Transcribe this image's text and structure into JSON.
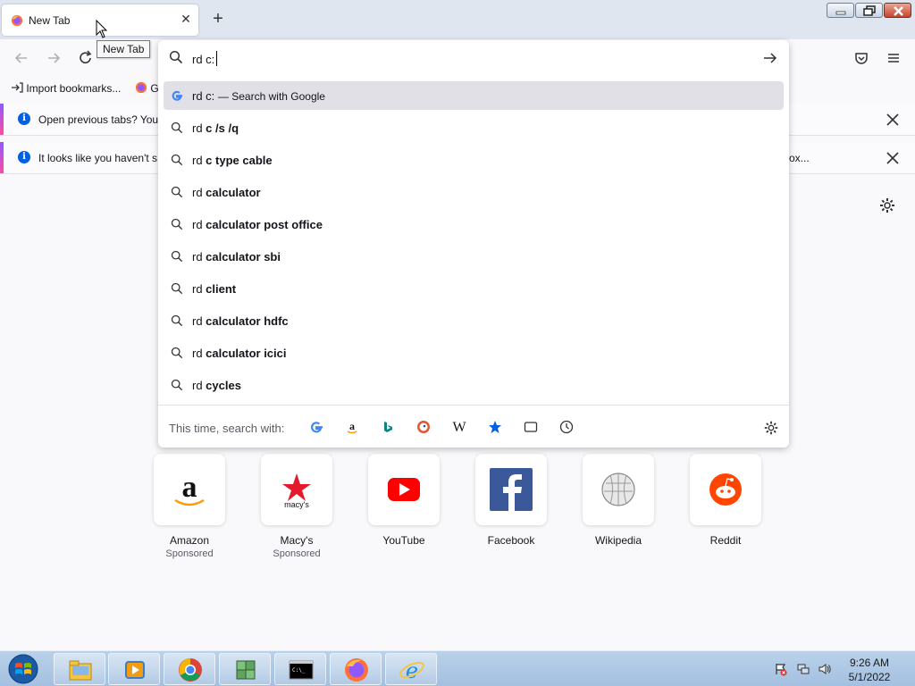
{
  "browser": {
    "tab": {
      "title": "New Tab",
      "tooltip": "New Tab"
    },
    "bookmarks": [
      {
        "label": "Import bookmarks...",
        "icon": "import-icon"
      },
      {
        "label": "G",
        "icon": "firefox-icon"
      }
    ],
    "notifications": [
      {
        "text": "Open previous tabs? You",
        "icon": "info-icon"
      },
      {
        "text": "It looks like you haven't s",
        "extra": "ox...",
        "icon": "info-icon"
      }
    ]
  },
  "urlbar": {
    "typed": "rd c:",
    "results": [
      {
        "prefix": "rd c:",
        "bold": "",
        "action": "— Search with Google",
        "icon": "google-icon"
      },
      {
        "prefix": "rd ",
        "bold": "c /s /q",
        "icon": "search-icon"
      },
      {
        "prefix": "rd ",
        "bold": "c type cable",
        "icon": "search-icon"
      },
      {
        "prefix": "rd ",
        "bold": "calculator",
        "icon": "search-icon"
      },
      {
        "prefix": "rd ",
        "bold": "calculator post office",
        "icon": "search-icon"
      },
      {
        "prefix": "rd ",
        "bold": "calculator sbi",
        "icon": "search-icon"
      },
      {
        "prefix": "rd ",
        "bold": "client",
        "icon": "search-icon"
      },
      {
        "prefix": "rd ",
        "bold": "calculator hdfc",
        "icon": "search-icon"
      },
      {
        "prefix": "rd ",
        "bold": "calculator icici",
        "icon": "search-icon"
      },
      {
        "prefix": "rd ",
        "bold": "cycles",
        "icon": "search-icon"
      }
    ],
    "one_off_label": "This time, search with:",
    "engines": [
      "google",
      "amazon",
      "bing",
      "duckduckgo",
      "wikipedia",
      "bookmarks",
      "tabs",
      "history"
    ]
  },
  "top_sites": [
    {
      "name": "Amazon",
      "sponsored": "Sponsored"
    },
    {
      "name": "Macy's",
      "sponsored": "Sponsored"
    },
    {
      "name": "YouTube"
    },
    {
      "name": "Facebook"
    },
    {
      "name": "Wikipedia"
    },
    {
      "name": "Reddit"
    }
  ],
  "taskbar": {
    "apps": [
      "explorer",
      "media-player",
      "chrome",
      "network-app",
      "command-prompt",
      "firefox",
      "internet-explorer"
    ],
    "time": "9:26 AM",
    "date": "5/1/2022"
  },
  "colors": {
    "accent": "#0060df",
    "taskbar": "#a4c0e0",
    "notif_stripe_top": "#9059ff",
    "notif_stripe_bottom": "#ff4aa2"
  }
}
